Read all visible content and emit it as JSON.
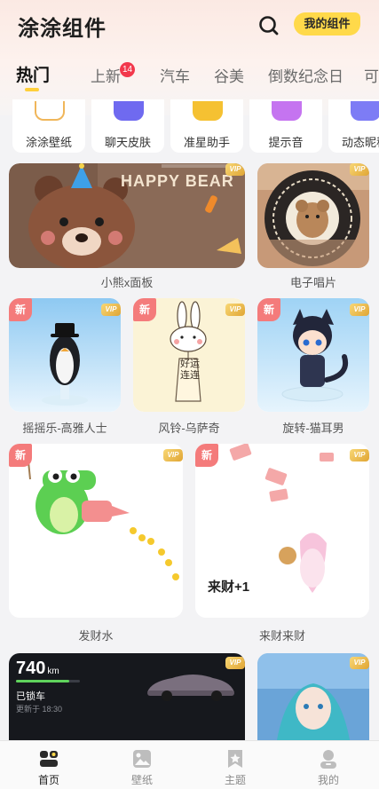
{
  "header": {
    "title": "涂涂组件",
    "search_icon": "search-icon",
    "my_widgets_label": "我的组件"
  },
  "tabs": [
    {
      "label": "热门",
      "active": true
    },
    {
      "label": "上新",
      "badge": "14"
    },
    {
      "label": "汽车"
    },
    {
      "label": "谷美"
    },
    {
      "label": "倒数纪念日"
    },
    {
      "label": "可"
    }
  ],
  "tools": [
    {
      "label": "涂涂壁纸",
      "icon": "wallpaper-icon"
    },
    {
      "label": "聊天皮肤",
      "icon": "chat-skin-icon"
    },
    {
      "label": "准星助手",
      "icon": "crosshair-icon"
    },
    {
      "label": "提示音",
      "icon": "bell-icon"
    },
    {
      "label": "动态昵称",
      "icon": "nickname-icon"
    }
  ],
  "cards": {
    "bear_panel": {
      "title": "小熊x面板",
      "art_text": "HAPPY BEAR",
      "vip": "VIP"
    },
    "record": {
      "title": "电子唱片",
      "vip": "VIP"
    },
    "penguin": {
      "title": "摇摇乐-高雅人士",
      "new": "新",
      "vip": "VIP"
    },
    "rabbit": {
      "title": "风铃-乌萨奇",
      "new": "新",
      "vip": "VIP",
      "tag_text": "好运连连"
    },
    "catboy": {
      "title": "旋转-猫耳男",
      "new": "新",
      "vip": "VIP"
    },
    "crocodile": {
      "title": "发财水",
      "new": "新",
      "vip": "VIP"
    },
    "fortune": {
      "title": "来财来财",
      "new": "新",
      "vip": "VIP",
      "art_text": "来财+1"
    },
    "car": {
      "range": "740",
      "unit": "km",
      "status": "已锁车",
      "updated": "更新于 18:30",
      "vip": "VIP"
    },
    "miku": {
      "vip": "VIP"
    }
  },
  "bottom_nav": [
    {
      "label": "首页",
      "icon": "home-icon",
      "active": true
    },
    {
      "label": "壁纸",
      "icon": "wallpaper-nav-icon"
    },
    {
      "label": "主题",
      "icon": "theme-star-icon"
    },
    {
      "label": "我的",
      "icon": "profile-icon"
    }
  ],
  "colors": {
    "accent_yellow": "#ffd94a",
    "badge_red": "#f2384c",
    "new_badge": "#f47b7b"
  }
}
